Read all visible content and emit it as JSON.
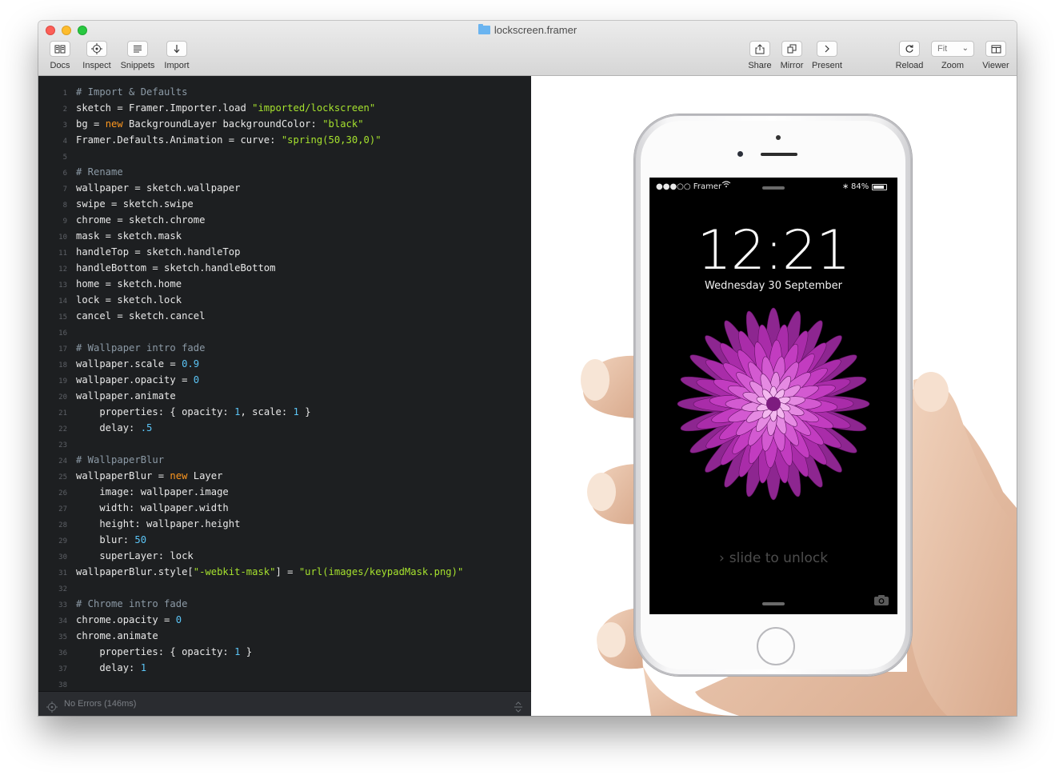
{
  "window": {
    "title": "lockscreen.framer",
    "toolbar_left": [
      {
        "label": "Docs",
        "icon": "book-icon"
      },
      {
        "label": "Inspect",
        "icon": "target-icon"
      },
      {
        "label": "Snippets",
        "icon": "list-icon"
      },
      {
        "label": "Import",
        "icon": "download-arrow-icon"
      }
    ],
    "toolbar_right": [
      {
        "label": "Share",
        "icon": "share-icon"
      },
      {
        "label": "Mirror",
        "icon": "mirror-icon"
      },
      {
        "label": "Present",
        "icon": "chevron-right-icon"
      },
      {
        "label": "Reload",
        "icon": "reload-icon"
      },
      {
        "label": "Zoom",
        "value": "Fit"
      },
      {
        "label": "Viewer",
        "icon": "viewer-icon"
      }
    ]
  },
  "editor": {
    "lines": [
      [
        [
          "c",
          "# Import & Defaults"
        ]
      ],
      [
        [
          "p",
          "sketch = Framer.Importer.load "
        ],
        [
          "s",
          "\"imported/lockscreen\""
        ]
      ],
      [
        [
          "p",
          "bg = "
        ],
        [
          "k",
          "new"
        ],
        [
          "p",
          " BackgroundLayer backgroundColor: "
        ],
        [
          "s",
          "\"black\""
        ]
      ],
      [
        [
          "p",
          "Framer.Defaults.Animation = curve: "
        ],
        [
          "s",
          "\"spring(50,30,0)\""
        ]
      ],
      [],
      [
        [
          "c",
          "# Rename"
        ]
      ],
      [
        [
          "p",
          "wallpaper = sketch.wallpaper"
        ]
      ],
      [
        [
          "p",
          "swipe = sketch.swipe"
        ]
      ],
      [
        [
          "p",
          "chrome = sketch.chrome"
        ]
      ],
      [
        [
          "p",
          "mask = sketch.mask"
        ]
      ],
      [
        [
          "p",
          "handleTop = sketch.handleTop"
        ]
      ],
      [
        [
          "p",
          "handleBottom = sketch.handleBottom"
        ]
      ],
      [
        [
          "p",
          "home = sketch.home"
        ]
      ],
      [
        [
          "p",
          "lock = sketch.lock"
        ]
      ],
      [
        [
          "p",
          "cancel = sketch.cancel"
        ]
      ],
      [],
      [
        [
          "c",
          "# Wallpaper intro fade"
        ]
      ],
      [
        [
          "p",
          "wallpaper.scale = "
        ],
        [
          "n",
          "0.9"
        ]
      ],
      [
        [
          "p",
          "wallpaper.opacity = "
        ],
        [
          "n",
          "0"
        ]
      ],
      [
        [
          "p",
          "wallpaper.animate"
        ]
      ],
      [
        [
          "p",
          "    properties: { opacity: "
        ],
        [
          "n",
          "1"
        ],
        [
          "p",
          ", scale: "
        ],
        [
          "n",
          "1"
        ],
        [
          "p",
          " }"
        ]
      ],
      [
        [
          "p",
          "    delay: "
        ],
        [
          "n",
          ".5"
        ]
      ],
      [],
      [
        [
          "c",
          "# WallpaperBlur"
        ]
      ],
      [
        [
          "p",
          "wallpaperBlur = "
        ],
        [
          "k",
          "new"
        ],
        [
          "p",
          " Layer"
        ]
      ],
      [
        [
          "p",
          "    image: wallpaper.image"
        ]
      ],
      [
        [
          "p",
          "    width: wallpaper.width"
        ]
      ],
      [
        [
          "p",
          "    height: wallpaper.height"
        ]
      ],
      [
        [
          "p",
          "    blur: "
        ],
        [
          "n",
          "50"
        ]
      ],
      [
        [
          "p",
          "    superLayer: lock"
        ]
      ],
      [
        [
          "p",
          "wallpaperBlur.style["
        ],
        [
          "s",
          "\"-webkit-mask\""
        ],
        [
          "p",
          "] = "
        ],
        [
          "s",
          "\"url(images/keypadMask.png)\""
        ]
      ],
      [],
      [
        [
          "c",
          "# Chrome intro fade"
        ]
      ],
      [
        [
          "p",
          "chrome.opacity = "
        ],
        [
          "n",
          "0"
        ]
      ],
      [
        [
          "p",
          "chrome.animate"
        ]
      ],
      [
        [
          "p",
          "    properties: { opacity: "
        ],
        [
          "n",
          "1"
        ],
        [
          "p",
          " }"
        ]
      ],
      [
        [
          "p",
          "    delay: "
        ],
        [
          "n",
          "1"
        ]
      ],
      []
    ],
    "status": "No Errors (146ms)"
  },
  "lockscreen": {
    "carrier": "●●●○○ Framer",
    "battery": "84%",
    "time": "12:21",
    "date": "Wednesday 30 September",
    "slide_text": "slide to unlock",
    "flower_color": "#c23cc0"
  }
}
